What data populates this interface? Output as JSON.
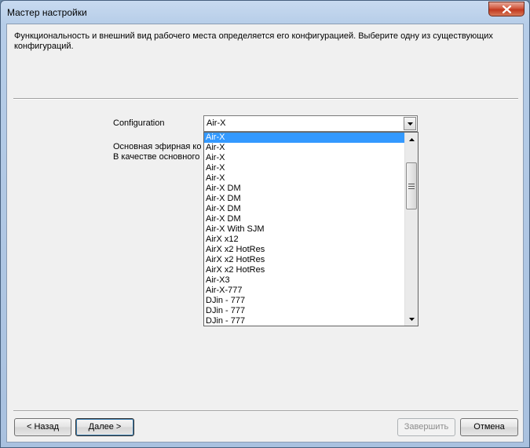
{
  "window": {
    "title": "Мастер настройки"
  },
  "intro_text": "Функциональность и внешний вид рабочего места определяется его конфигурацией. Выберите одну из существующих конфигураций.",
  "configuration": {
    "label": "Configuration",
    "selected_value": "Air-X",
    "hidden_label_line1": "Основная эфирная ко",
    "hidden_label_line2": "В качестве основного",
    "options": [
      "Air-X",
      "Air-X",
      "Air-X",
      "Air-X",
      "Air-X",
      "Air-X DM",
      "Air-X DM",
      "Air-X DM",
      "Air-X DM",
      "Air-X With SJM",
      "AirX x12",
      "AirX x2 HotRes",
      "AirX x2 HotRes",
      "AirX x2 HotRes",
      "Air-X3",
      "Air-X-777",
      "DJin - 777",
      "DJin - 777",
      "DJin - 777"
    ],
    "selected_index": 0
  },
  "buttons": {
    "back": "< Назад",
    "next": "Далее >",
    "finish": "Завершить",
    "cancel": "Отмена"
  }
}
